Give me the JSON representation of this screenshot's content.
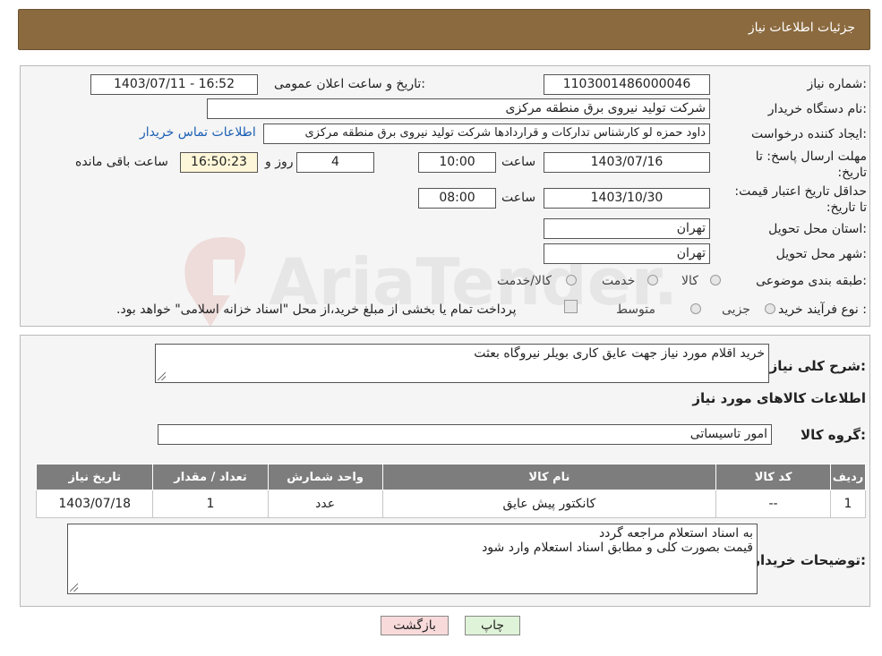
{
  "header": {
    "title": "جزئیات اطلاعات نیاز"
  },
  "form": {
    "need_number_label": "شماره نیاز:",
    "need_number": "1103001486000046",
    "announce_label": "تاریخ و ساعت اعلان عمومی:",
    "announce_value": "1403/07/11 - 16:52",
    "buyer_org_label": "نام دستگاه خریدار:",
    "buyer_org": "شرکت تولید نیروی برق منطقه مرکزی",
    "requester_label": "ایجاد کننده درخواست:",
    "requester": "داود حمزه لو کارشناس تدارکات و قراردادها شرکت تولید نیروی برق منطقه مرکزی",
    "contact_link": "اطلاعات تماس خریدار",
    "reply_deadline_label": "مهلت ارسال پاسخ: تا تاریخ:",
    "reply_date": "1403/07/16",
    "time_label": "ساعت",
    "reply_time": "10:00",
    "days": "4",
    "days_label": "روز و",
    "remaining_time": "16:50:23",
    "remaining_label": "ساعت باقی مانده",
    "validity_label": "حداقل تاریخ اعتبار قیمت: تا تاریخ:",
    "validity_date": "1403/10/30",
    "validity_time": "08:00",
    "province_label": "استان محل تحویل:",
    "province": "تهران",
    "city_label": "شهر محل تحویل:",
    "city": "تهران",
    "category_label": "طبقه بندی موضوعی:",
    "category_options": [
      "کالا",
      "خدمت",
      "کالا/خدمت"
    ],
    "process_label": "نوع فرآیند خرید :",
    "process_options": [
      "جزیی",
      "متوسط"
    ],
    "process_note": "پرداخت تمام یا بخشی از مبلغ خرید،از محل \"اسناد خزانه اسلامی\" خواهد بود."
  },
  "summary": {
    "description_label": "شرح کلی نیاز:",
    "description": "خرید اقلام مورد نیاز جهت عایق کاری بویلر نیروگاه بعثت",
    "items_title": "اطلاعات کالاهای مورد نیاز",
    "group_label": "گروه کالا:",
    "group_value": "امور تاسیساتی",
    "table_headers": [
      "ردیف",
      "کد کالا",
      "نام کالا",
      "واحد شمارش",
      "تعداد / مقدار",
      "تاریخ نیاز"
    ],
    "rows": [
      [
        "1",
        "--",
        "کانکتور پیش عایق",
        "عدد",
        "1",
        "1403/07/18"
      ]
    ],
    "buyer_notes_label": "توضیحات خریدار:",
    "buyer_notes_line1": "به اسناد استعلام مراجعه گردد",
    "buyer_notes_line2": "قیمت بصورت کلی و مطابق اسناد استعلام وارد شود"
  },
  "buttons": {
    "print": "چاپ",
    "back": "بازگشت"
  },
  "watermark": {
    "text": "AriaTender.neT"
  },
  "colors": {
    "header": "#8b6a3f",
    "table_header": "#7d7d7d",
    "print_btn": "#dff3d8",
    "back_btn": "#f8dada"
  }
}
